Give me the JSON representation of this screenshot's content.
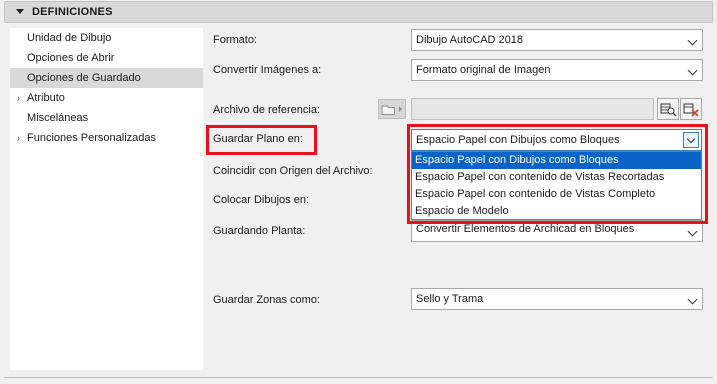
{
  "header": {
    "title": "DEFINICIONES"
  },
  "sidebar": {
    "items": [
      {
        "label": "Unidad de Dibujo",
        "selected": false,
        "expandable": false
      },
      {
        "label": "Opciones de Abrir",
        "selected": false,
        "expandable": false
      },
      {
        "label": "Opciones de Guardado",
        "selected": true,
        "expandable": false
      },
      {
        "label": "Atributo",
        "selected": false,
        "expandable": true
      },
      {
        "label": "Misceláneas",
        "selected": false,
        "expandable": false
      },
      {
        "label": "Funciones Personalizadas",
        "selected": false,
        "expandable": true
      }
    ]
  },
  "form": {
    "formato": {
      "label": "Formato:",
      "value": "Dibujo AutoCAD 2018"
    },
    "convertir_imagenes": {
      "label": "Convertir Imágenes a:",
      "value": "Formato original de Imagen"
    },
    "archivo_referencia": {
      "label": "Archivo de referencia:",
      "value": ""
    },
    "guardar_plano": {
      "label": "Guardar Plano en:",
      "value": "Espacio Papel con Dibujos como Bloques"
    },
    "coincidir_origen": {
      "label": "Coincidir con Origen del Archivo:"
    },
    "colocar_dibujos": {
      "label": "Colocar Dibujos en:"
    },
    "guardando_planta": {
      "label": "Guardando Planta:",
      "value": "Convertir Elementos de Archicad en Bloques"
    },
    "guardar_zonas": {
      "label": "Guardar Zonas como:",
      "value": "Sello y Trama"
    }
  },
  "dropdown": {
    "options": [
      "Espacio Papel con Dibujos como Bloques",
      "Espacio Papel con contenido de Vistas Recortadas",
      "Espacio Papel con contenido de Vistas Completo",
      "Espacio de Modelo"
    ],
    "selected_index": 0
  },
  "colors": {
    "highlight": "#e8111b",
    "selection": "#0a64c8",
    "focus_border": "#3c7fb1"
  },
  "icons": [
    "collapse-triangle-icon",
    "expand-arrow-icon",
    "folder-browse-icon",
    "chevron-down-icon",
    "table-search-icon",
    "clear-x-icon"
  ]
}
